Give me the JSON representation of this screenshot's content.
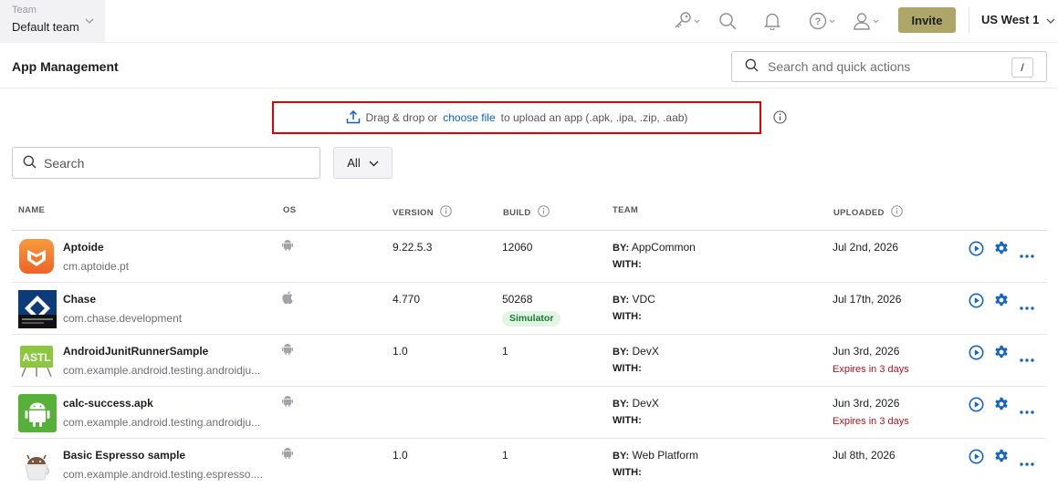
{
  "topbar": {
    "team_label": "Team",
    "team_value": "Default team",
    "invite_label": "Invite",
    "region": "US West 1",
    "icons": [
      "key-icon",
      "search-icon",
      "bell-icon",
      "help-icon",
      "user-icon"
    ]
  },
  "header": {
    "title": "App Management",
    "quick_search_placeholder": "Search and quick actions",
    "shortcut_key": "/"
  },
  "upload": {
    "prefix": "Drag & drop or",
    "link": "choose file",
    "suffix": "to upload an app (.apk, .ipa, .zip, .aab)"
  },
  "filters": {
    "search_placeholder": "Search",
    "os_filter_value": "All"
  },
  "table": {
    "columns": {
      "name": "NAME",
      "os": "OS",
      "version": "VERSION",
      "build": "BUILD",
      "team": "TEAM",
      "uploaded": "UPLOADED"
    },
    "by_label": "BY:",
    "with_label": "WITH:",
    "rows": [
      {
        "name": "Aptoide",
        "package": "cm.aptoide.pt",
        "os": "android",
        "version": "9.22.5.3",
        "build": "12060",
        "badge": "",
        "team_by": "AppCommon",
        "uploaded": "Jul 2nd, 2026",
        "expires": ""
      },
      {
        "name": "Chase",
        "package": "com.chase.development",
        "os": "ios",
        "version": "4.770",
        "build": "50268",
        "badge": "Simulator",
        "team_by": "VDC",
        "uploaded": "Jul 17th, 2026",
        "expires": ""
      },
      {
        "name": "AndroidJunitRunnerSample",
        "package": "com.example.android.testing.androidju...",
        "os": "android",
        "version": "1.0",
        "build": "1",
        "badge": "",
        "team_by": "DevX",
        "uploaded": "Jun 3rd, 2026",
        "expires": "Expires in 3 days"
      },
      {
        "name": "calc-success.apk",
        "package": "com.example.android.testing.androidju...",
        "os": "android",
        "version": "",
        "build": "",
        "badge": "",
        "team_by": "DevX",
        "uploaded": "Jun 3rd, 2026",
        "expires": "Expires in 3 days"
      },
      {
        "name": "Basic Espresso sample",
        "package": "com.example.android.testing.espresso....",
        "os": "android",
        "version": "1.0",
        "build": "1",
        "badge": "",
        "team_by": "Web Platform",
        "uploaded": "Jul 8th, 2026",
        "expires": ""
      }
    ],
    "app_icon_text": {
      "astl": "ASTL"
    }
  },
  "colors": {
    "invite_bg": "#aea569",
    "link": "#0b63c7",
    "action_blue": "#1565c0",
    "expires_red": "#b3141c",
    "highlight_border": "#e00000"
  }
}
